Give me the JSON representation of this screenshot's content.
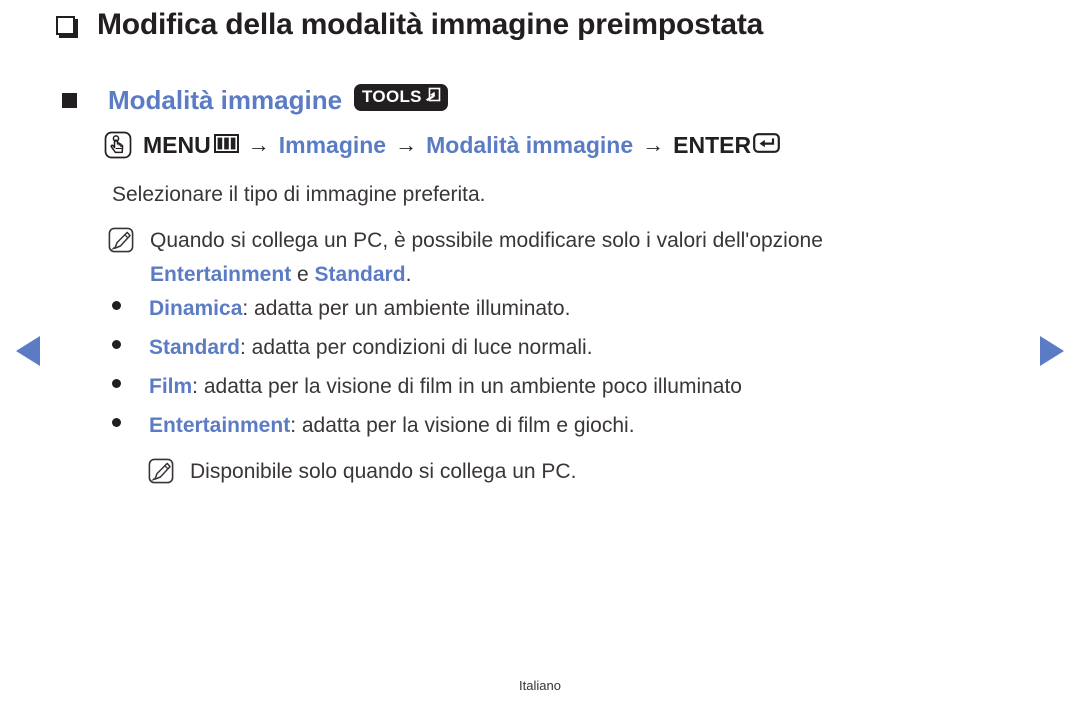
{
  "page": {
    "title": "Modifica della modalità immagine preimpostata",
    "footer_language": "Italiano",
    "accent_color": "#5b7cc4",
    "text_color": "#231f20"
  },
  "nav": {
    "prev_label": "◀",
    "next_label": "▶",
    "prev_icon": "triangle-left-icon",
    "next_icon": "triangle-right-icon"
  },
  "section": {
    "heading": "Modalità immagine",
    "tools_badge": "TOOLS",
    "tools_badge_icon": "return-arrow-box-icon"
  },
  "menu_path": {
    "touch_icon": "hand-press-icon",
    "menu_label": "MENU",
    "menu_icon": "menu-bars-box-icon",
    "arrow": "→",
    "step_1": "Immagine",
    "step_2": "Modalità immagine",
    "enter_label": "ENTER",
    "enter_icon": "enter-key-icon"
  },
  "intro": "Selezionare il tipo di immagine preferita.",
  "notes": [
    {
      "icon": "note-pencil-icon",
      "line_1": "Quando si collega un PC, è possibile modificare solo i valori dell'opzione",
      "keyword_1": "Entertainment",
      "conjunction": " e ",
      "keyword_2": "Standard",
      "line_2_suffix": "."
    },
    {
      "icon": "note-pencil-icon",
      "line_1": "Disponibile solo quando si collega un PC."
    }
  ],
  "picture_modes": [
    {
      "term": "Dinamica",
      "desc": ": adatta per un ambiente illuminato."
    },
    {
      "term": "Standard",
      "desc": ": adatta per condizioni di luce normali."
    },
    {
      "term": "Film",
      "desc": ": adatta per la visione di film in un ambiente poco illuminato"
    },
    {
      "term": "Entertainment",
      "desc": ": adatta per la visione di film e giochi."
    }
  ]
}
